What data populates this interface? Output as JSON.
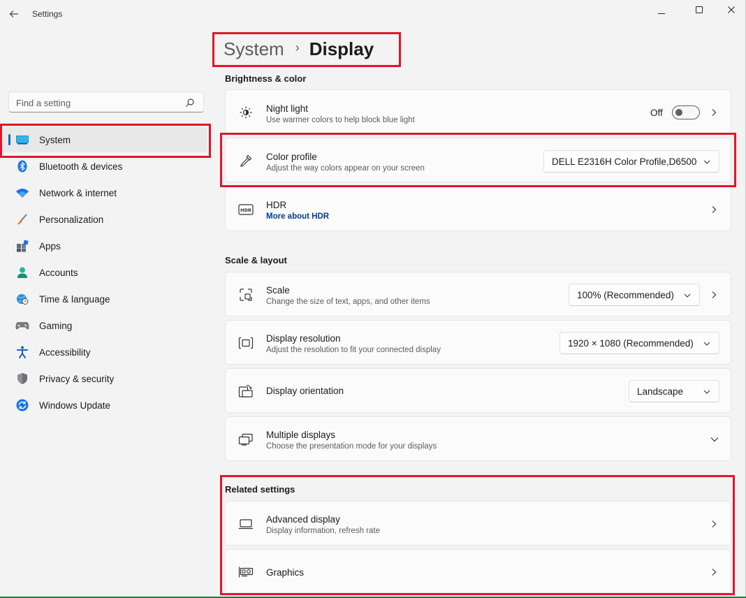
{
  "window": {
    "app_title": "Settings"
  },
  "sidebar": {
    "search_placeholder": "Find a setting",
    "items": [
      {
        "label": "System",
        "icon": "system-icon",
        "active": true
      },
      {
        "label": "Bluetooth & devices",
        "icon": "bluetooth-icon"
      },
      {
        "label": "Network & internet",
        "icon": "wifi-icon"
      },
      {
        "label": "Personalization",
        "icon": "brush-icon"
      },
      {
        "label": "Apps",
        "icon": "apps-icon"
      },
      {
        "label": "Accounts",
        "icon": "accounts-icon"
      },
      {
        "label": "Time & language",
        "icon": "globe-clock-icon"
      },
      {
        "label": "Gaming",
        "icon": "gamepad-icon"
      },
      {
        "label": "Accessibility",
        "icon": "accessibility-icon"
      },
      {
        "label": "Privacy & security",
        "icon": "shield-icon"
      },
      {
        "label": "Windows Update",
        "icon": "update-icon"
      }
    ]
  },
  "breadcrumb": {
    "parent": "System",
    "current": "Display"
  },
  "sections": {
    "brightness": {
      "title": "Brightness & color",
      "night_light": {
        "title": "Night light",
        "subtitle": "Use warmer colors to help block blue light",
        "state_label": "Off"
      },
      "color_profile": {
        "title": "Color profile",
        "subtitle": "Adjust the way colors appear on your screen",
        "value": "DELL E2316H Color Profile,D6500"
      },
      "hdr": {
        "title": "HDR",
        "link": "More about HDR"
      }
    },
    "scale_layout": {
      "title": "Scale & layout",
      "scale": {
        "title": "Scale",
        "subtitle": "Change the size of text, apps, and other items",
        "value": "100% (Recommended)"
      },
      "resolution": {
        "title": "Display resolution",
        "subtitle": "Adjust the resolution to fit your connected display",
        "value": "1920 × 1080 (Recommended)"
      },
      "orientation": {
        "title": "Display orientation",
        "value": "Landscape"
      },
      "multiple": {
        "title": "Multiple displays",
        "subtitle": "Choose the presentation mode for your displays"
      }
    },
    "related": {
      "title": "Related settings",
      "advanced": {
        "title": "Advanced display",
        "subtitle": "Display information, refresh rate"
      },
      "graphics": {
        "title": "Graphics"
      }
    }
  },
  "colors": {
    "accent": "#0067c0",
    "highlight": "#e0162b",
    "link": "#003e92"
  }
}
